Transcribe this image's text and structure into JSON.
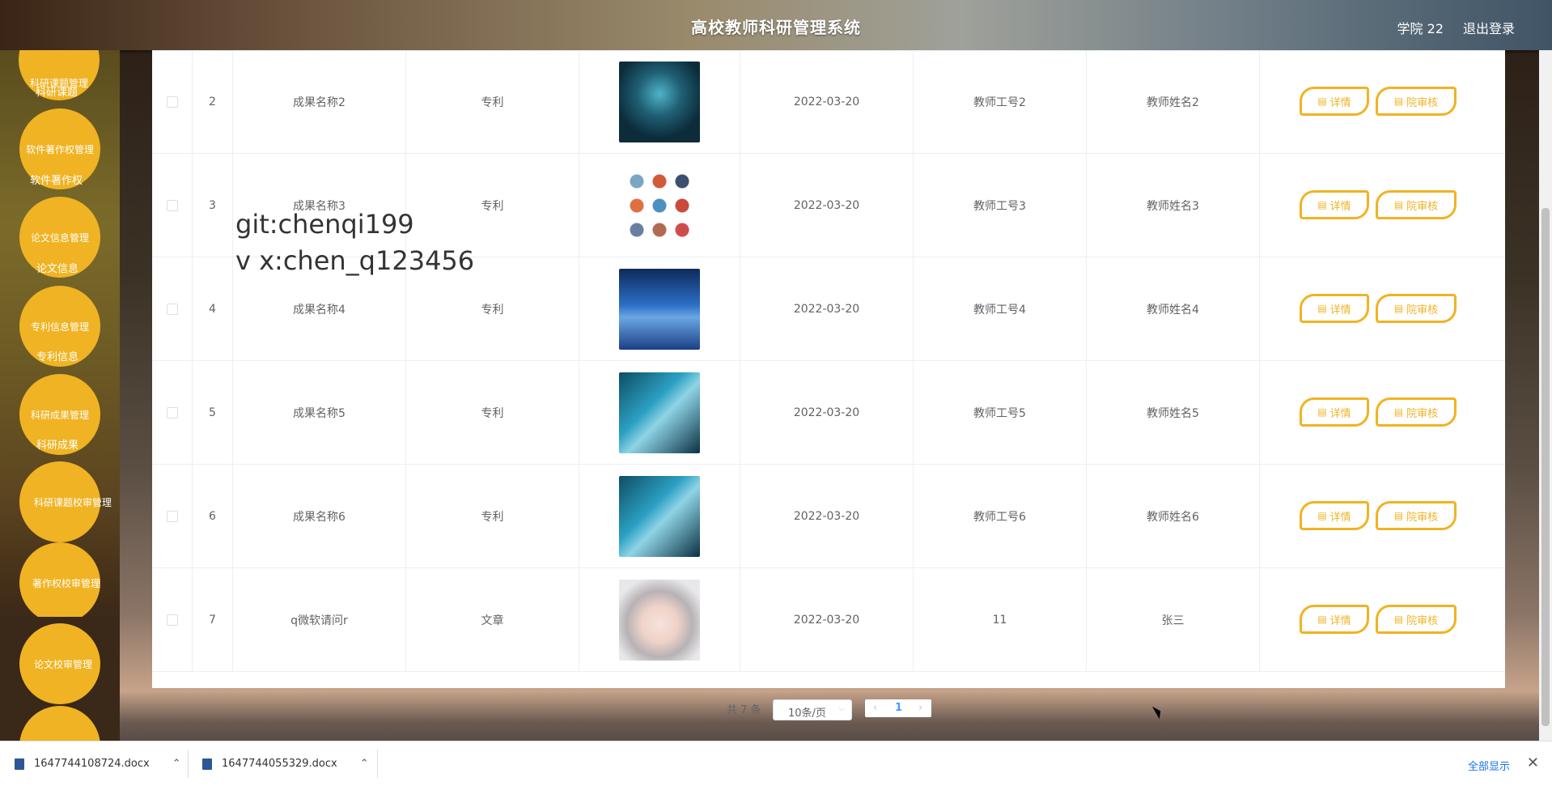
{
  "header": {
    "title": "高校教师科研管理系统",
    "user": "学院 22",
    "logout": "退出登录"
  },
  "sidebar": {
    "items": [
      {
        "main": "科研课题管理",
        "sub": "科研课题"
      },
      {
        "main": "软件著作权管理",
        "sub": "软件著作权"
      },
      {
        "main": "论文信息管理",
        "sub": "论文信息"
      },
      {
        "main": "专利信息管理",
        "sub": "专利信息"
      },
      {
        "main": "科研成果管理",
        "sub": "科研成果"
      },
      {
        "main": "科研课题校审管理",
        "sub": ""
      },
      {
        "main": "著作权校审管理",
        "sub": ""
      },
      {
        "main": "论文校审管理",
        "sub": ""
      }
    ]
  },
  "table": {
    "rows": [
      {
        "index": "2",
        "name": "成果名称2",
        "type": "专利",
        "date": "2022-03-20",
        "teacher_no": "教师工号2",
        "teacher_name": "教师姓名2",
        "image": "light-bulb"
      },
      {
        "index": "3",
        "name": "成果名称3",
        "type": "专利",
        "date": "2022-03-20",
        "teacher_no": "教师工号3",
        "teacher_name": "教师姓名3",
        "image": "science-icons"
      },
      {
        "index": "4",
        "name": "成果名称4",
        "type": "专利",
        "date": "2022-03-20",
        "teacher_no": "教师工号4",
        "teacher_name": "教师姓名4",
        "image": "blue-lab"
      },
      {
        "index": "5",
        "name": "成果名称5",
        "type": "专利",
        "date": "2022-03-20",
        "teacher_no": "教师工号5",
        "teacher_name": "教师姓名5",
        "image": "circuit-board"
      },
      {
        "index": "6",
        "name": "成果名称6",
        "type": "专利",
        "date": "2022-03-20",
        "teacher_no": "教师工号6",
        "teacher_name": "教师姓名6",
        "image": "circuit-board"
      },
      {
        "index": "7",
        "name": "q微软请问r",
        "type": "文章",
        "date": "2022-03-20",
        "teacher_no": "11",
        "teacher_name": "张三",
        "image": "anime-girl"
      }
    ],
    "detail_label": "详情",
    "review_label": "院审核"
  },
  "watermark": {
    "line1": "git:chenqi199",
    "line2": "v x:chen_q123456"
  },
  "pagination": {
    "total": "共 7 条",
    "page_size": "10条/页",
    "current_page": "1",
    "prev": "‹",
    "next": "›"
  },
  "downloads": {
    "file1": "1647744108724.docx",
    "file2": "1647744055329.docx",
    "show_all": "全部显示",
    "close": "✕"
  },
  "colors": {
    "accent": "#f0b323"
  }
}
